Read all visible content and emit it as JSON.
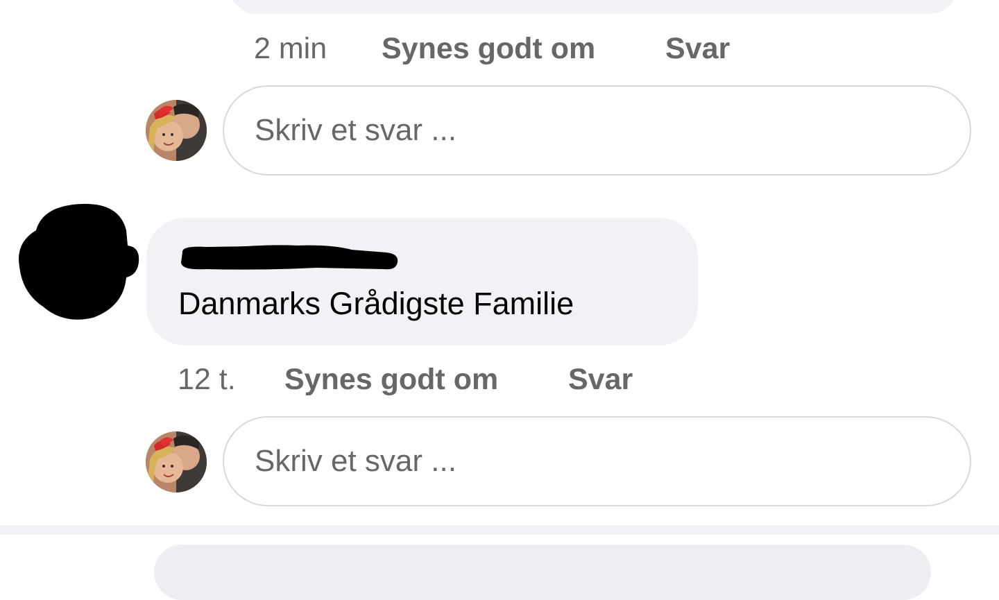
{
  "thread": {
    "previous_comment": {
      "time": "2 min",
      "like_label": "Synes godt om",
      "reply_label": "Svar"
    },
    "reply_box_1": {
      "placeholder": "Skriv et svar ..."
    },
    "comment": {
      "author_redacted": true,
      "text": "Danmarks Grådigste Familie",
      "time": "12 t.",
      "like_label": "Synes godt om",
      "reply_label": "Svar"
    },
    "reply_box_2": {
      "placeholder": "Skriv et svar ..."
    }
  },
  "icons": {
    "current_user_avatar": "user-avatar-photo",
    "commenter_avatar": "redacted-avatar"
  },
  "colors": {
    "bubble_bg": "#f0f2f5",
    "secondary_text": "#65676b",
    "primary_text": "#050505",
    "input_border": "#d6d8dc"
  }
}
